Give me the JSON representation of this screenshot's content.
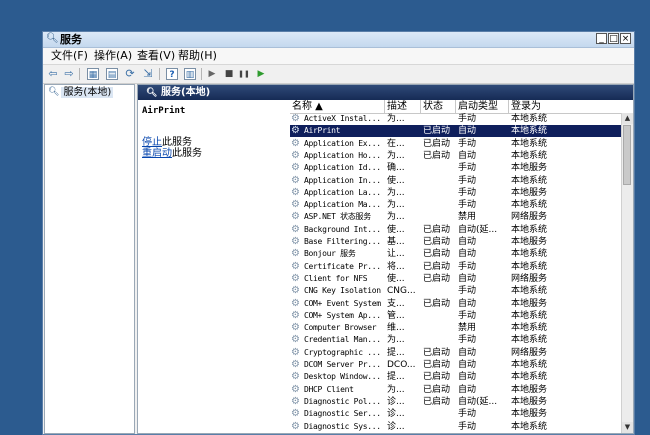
{
  "window": {
    "title": "服务",
    "icon": "magnifier-icon",
    "buttons": {
      "minimize": "_",
      "maximize": "□",
      "close": "×"
    }
  },
  "menu": {
    "file": "文件(F)",
    "action": "操作(A)",
    "view": "查看(V)",
    "help": "帮助(H)"
  },
  "toolbar": {
    "icons": [
      "back-arrow-icon",
      "forward-arrow-icon",
      "console-tree-icon",
      "properties-icon",
      "refresh-icon",
      "export-icon",
      "help-icon",
      "view-icon",
      "start-icon",
      "stop-icon",
      "pause-icon",
      "restart-icon"
    ],
    "glyphs": {
      "back": "⇦",
      "forward": "⇨",
      "tree": "▦",
      "props": "▤",
      "refresh": "⟳",
      "export": "⇲",
      "help": "?",
      "view": "▥",
      "start": "▶",
      "stop": "■",
      "pause": "❚❚",
      "restart": "▶"
    }
  },
  "tree": {
    "label": "服务(本地)"
  },
  "content": {
    "header": "服务(本地)",
    "selected_service": "AirPrint",
    "links": {
      "stop": "停止",
      "stop_suffix": "此服务",
      "restart": "重启动",
      "restart_suffix": "此服务"
    }
  },
  "columns": {
    "name": "名称 ▲",
    "desc": "描述",
    "status": "状态",
    "startup": "启动类型",
    "logon": "登录为"
  },
  "services": [
    {
      "name": "ActiveX Instal...",
      "desc": "为...",
      "status": "",
      "startup": "手动",
      "logon": "本地系统"
    },
    {
      "name": "AirPrint",
      "desc": "",
      "status": "已启动",
      "startup": "自动",
      "logon": "本地系统",
      "selected": true
    },
    {
      "name": "Application Ex...",
      "desc": "在...",
      "status": "已启动",
      "startup": "手动",
      "logon": "本地系统"
    },
    {
      "name": "Application Ho...",
      "desc": "为...",
      "status": "已启动",
      "startup": "自动",
      "logon": "本地系统"
    },
    {
      "name": "Application Id...",
      "desc": "确...",
      "status": "",
      "startup": "手动",
      "logon": "本地服务"
    },
    {
      "name": "Application In...",
      "desc": "使...",
      "status": "",
      "startup": "手动",
      "logon": "本地系统"
    },
    {
      "name": "Application La...",
      "desc": "为...",
      "status": "",
      "startup": "手动",
      "logon": "本地服务"
    },
    {
      "name": "Application Ma...",
      "desc": "为...",
      "status": "",
      "startup": "手动",
      "logon": "本地系统"
    },
    {
      "name": "ASP.NET 状态服务",
      "desc": "为...",
      "status": "",
      "startup": "禁用",
      "logon": "网络服务"
    },
    {
      "name": "Background Int...",
      "desc": "使...",
      "status": "已启动",
      "startup": "自动(延...",
      "logon": "本地系统"
    },
    {
      "name": "Base Filtering...",
      "desc": "基...",
      "status": "已启动",
      "startup": "自动",
      "logon": "本地服务"
    },
    {
      "name": "Bonjour 服务",
      "desc": "让...",
      "status": "已启动",
      "startup": "自动",
      "logon": "本地系统"
    },
    {
      "name": "Certificate Pr...",
      "desc": "将...",
      "status": "已启动",
      "startup": "手动",
      "logon": "本地系统"
    },
    {
      "name": "Client for NFS",
      "desc": "使...",
      "status": "已启动",
      "startup": "自动",
      "logon": "网络服务"
    },
    {
      "name": "CNG Key Isolation",
      "desc": "CNG...",
      "status": "",
      "startup": "手动",
      "logon": "本地系统"
    },
    {
      "name": "COM+ Event System",
      "desc": "支...",
      "status": "已启动",
      "startup": "自动",
      "logon": "本地服务"
    },
    {
      "name": "COM+ System Ap...",
      "desc": "管...",
      "status": "",
      "startup": "手动",
      "logon": "本地系统"
    },
    {
      "name": "Computer Browser",
      "desc": "维...",
      "status": "",
      "startup": "禁用",
      "logon": "本地系统"
    },
    {
      "name": "Credential Man...",
      "desc": "为...",
      "status": "",
      "startup": "手动",
      "logon": "本地系统"
    },
    {
      "name": "Cryptographic ...",
      "desc": "提...",
      "status": "已启动",
      "startup": "自动",
      "logon": "网络服务"
    },
    {
      "name": "DCOM Server Pr...",
      "desc": "DCO...",
      "status": "已启动",
      "startup": "自动",
      "logon": "本地系统"
    },
    {
      "name": "Desktop Window...",
      "desc": "提...",
      "status": "已启动",
      "startup": "自动",
      "logon": "本地系统"
    },
    {
      "name": "DHCP Client",
      "desc": "为...",
      "status": "已启动",
      "startup": "自动",
      "logon": "本地服务"
    },
    {
      "name": "Diagnostic Pol...",
      "desc": "诊...",
      "status": "已启动",
      "startup": "自动(延...",
      "logon": "本地服务"
    },
    {
      "name": "Diagnostic Ser...",
      "desc": "诊...",
      "status": "",
      "startup": "手动",
      "logon": "本地服务"
    },
    {
      "name": "Diagnostic Sys...",
      "desc": "诊...",
      "status": "",
      "startup": "手动",
      "logon": "本地系统"
    }
  ]
}
